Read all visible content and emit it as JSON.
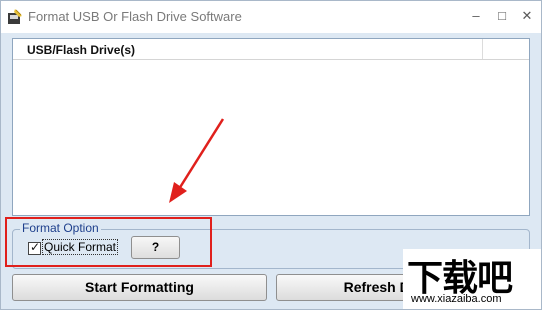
{
  "window": {
    "title": "Format USB Or Flash Drive Software",
    "minimize": "–",
    "maximize": "□",
    "close": "✕"
  },
  "drive_list": {
    "columns": [
      "USB/Flash Drive(s)"
    ],
    "rows": []
  },
  "format_option": {
    "group_label": "Format Option",
    "quick_format_label": "Quick Format",
    "quick_format_checked": true,
    "help_label": "?"
  },
  "buttons": {
    "start": "Start Formatting",
    "refresh": "Refresh Drive List"
  },
  "annotation": {
    "highlight_color": "#e0201c",
    "arrow_color": "#e0201c"
  },
  "watermark": {
    "text": "下载吧",
    "url": "www.xiazaiba.com"
  }
}
